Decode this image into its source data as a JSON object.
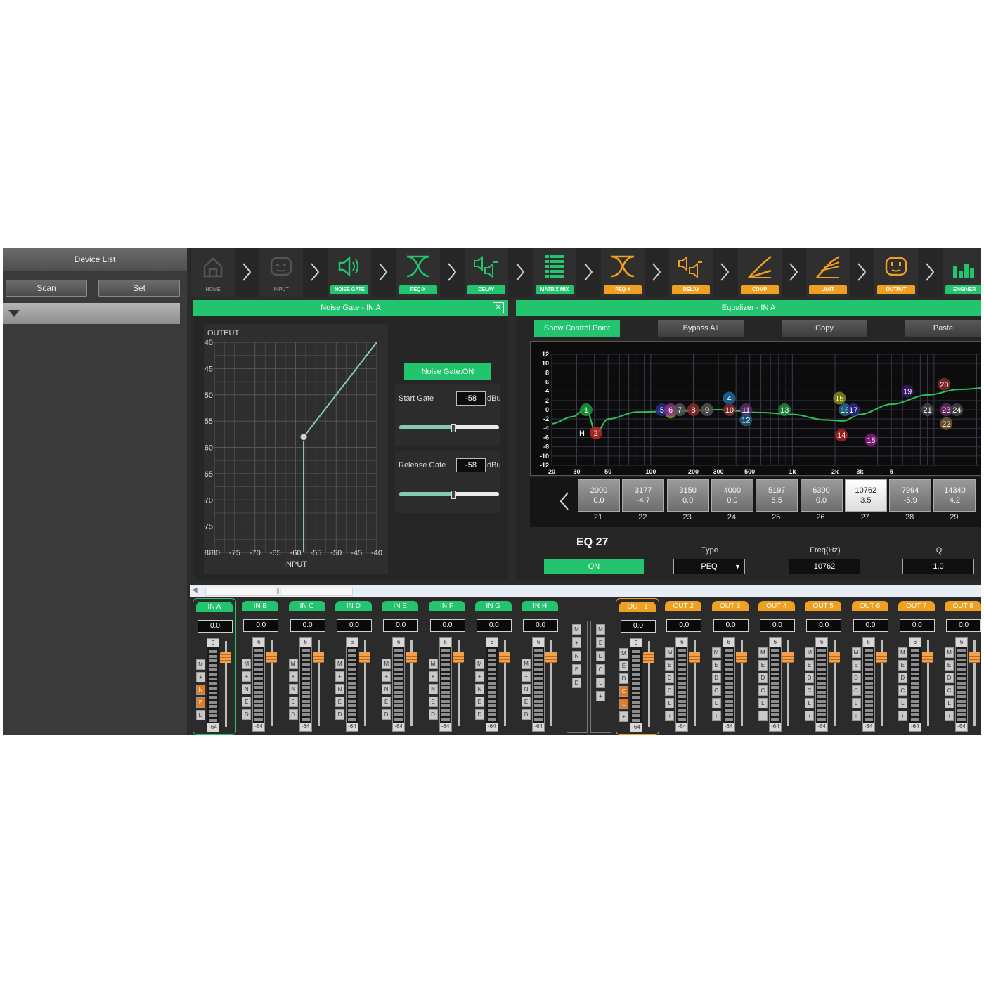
{
  "sidebar": {
    "title": "Device List",
    "scan_label": "Scan",
    "set_label": "Set"
  },
  "toolbar": {
    "items": [
      {
        "label": "HOME",
        "icon": "home-icon",
        "active": false
      },
      {
        "label": "INPUT",
        "icon": "input-icon",
        "active": false
      },
      {
        "label": "NOISE GATE",
        "icon": "speaker-icon",
        "active": true,
        "color": "#22c46e"
      },
      {
        "label": "PEQ-X",
        "icon": "crossover-icon",
        "active": true,
        "color": "#22c46e"
      },
      {
        "label": "DELAY",
        "icon": "delay-speakers-icon",
        "active": true,
        "color": "#22c46e"
      },
      {
        "label": "MATRIX MIX",
        "icon": "matrix-icon",
        "active": true,
        "color": "#22c46e"
      },
      {
        "label": "PEQ-X",
        "icon": "crossover-icon",
        "active": true,
        "color": "#f0a020"
      },
      {
        "label": "DELAY",
        "icon": "delay-speakers-icon",
        "active": true,
        "color": "#f0a020"
      },
      {
        "label": "COMP",
        "icon": "compressor-icon",
        "active": true,
        "color": "#f0a020"
      },
      {
        "label": "LIMIT",
        "icon": "limiter-icon",
        "active": true,
        "color": "#f0a020"
      },
      {
        "label": "OUTPUT",
        "icon": "output-icon",
        "active": true,
        "color": "#f0a020"
      },
      {
        "label": "ENGINER",
        "icon": "meters-icon",
        "active": true,
        "color": "#22c46e"
      }
    ]
  },
  "noise_gate": {
    "title": "Noise Gate - IN A",
    "on_label": "Noise Gate:ON",
    "start_label": "Start Gate",
    "start_value": "-58",
    "start_level": 0.54,
    "release_label": "Release Gate",
    "release_value": "-58",
    "release_level": 0.54,
    "unit": "dBu",
    "y_title": "OUTPUT",
    "x_title": "INPUT",
    "y_ticks": [
      "-40",
      "-45",
      "-50",
      "-55",
      "-60",
      "-65",
      "-70",
      "-75",
      "-80"
    ],
    "x_ticks": [
      "-80",
      "-75",
      "-70",
      "-65",
      "-60",
      "-55",
      "-50",
      "-45",
      "-40"
    ],
    "threshold": -58
  },
  "equalizer": {
    "title": "Equalizer - IN A",
    "show_points_label": "Show Control Point",
    "bypass_label": "Bypass All",
    "copy_label": "Copy",
    "paste_label": "Paste",
    "y_ticks": [
      "12",
      "10",
      "8",
      "6",
      "4",
      "2",
      "0",
      "-2",
      "-4",
      "-6",
      "-8",
      "-10",
      "-12"
    ],
    "x_ticks": [
      "20",
      "30",
      "50",
      "100",
      "200",
      "300",
      "500",
      "1k",
      "2k",
      "3k",
      "5"
    ],
    "points": [
      {
        "n": "1",
        "f": 35,
        "g": 0,
        "c": "#1e9a3a"
      },
      {
        "n": "2",
        "f": 41,
        "g": -5,
        "c": "#c0282a"
      },
      {
        "n": "3",
        "f": 138,
        "g": -0.5,
        "c": "#a08a2a"
      },
      {
        "n": "4",
        "f": 358,
        "g": 2.5,
        "c": "#1e6aa0"
      },
      {
        "n": "5",
        "f": 120,
        "g": 0,
        "c": "#2a2a8a"
      },
      {
        "n": "6",
        "f": 138,
        "g": 0,
        "c": "#8a2a8a"
      },
      {
        "n": "7",
        "f": 160,
        "g": 0,
        "c": "#555555"
      },
      {
        "n": "8",
        "f": 200,
        "g": 0,
        "c": "#8a2a2a"
      },
      {
        "n": "9",
        "f": 250,
        "g": 0,
        "c": "#555555"
      },
      {
        "n": "10",
        "f": 360,
        "g": 0,
        "c": "#7a2a2a"
      },
      {
        "n": "11",
        "f": 470,
        "g": 0,
        "c": "#5a2a6a"
      },
      {
        "n": "12",
        "f": 470,
        "g": -2.2,
        "c": "#1e5a7a"
      },
      {
        "n": "13",
        "f": 880,
        "g": 0,
        "c": "#1e8a3a"
      },
      {
        "n": "14",
        "f": 2220,
        "g": -5.5,
        "c": "#b02020"
      },
      {
        "n": "15",
        "f": 2150,
        "g": 2.5,
        "c": "#8a8a1a"
      },
      {
        "n": "16",
        "f": 2350,
        "g": 0,
        "c": "#1e6a8a"
      },
      {
        "n": "17",
        "f": 2700,
        "g": 0,
        "c": "#2a2a8a"
      },
      {
        "n": "18",
        "f": 3600,
        "g": -6.5,
        "c": "#8a1a8a"
      },
      {
        "n": "19",
        "f": 6500,
        "g": 4,
        "c": "#3a1a6a"
      },
      {
        "n": "20",
        "f": 11800,
        "g": 5.5,
        "c": "#8a2a2a"
      },
      {
        "n": "21",
        "f": 9000,
        "g": 0,
        "c": "#444444"
      },
      {
        "n": "22",
        "f": 12200,
        "g": -3,
        "c": "#7a5a3a"
      },
      {
        "n": "23",
        "f": 12200,
        "g": 0,
        "c": "#6a2a6a"
      },
      {
        "n": "24",
        "f": 14500,
        "g": 0,
        "c": "#444444"
      }
    ],
    "bands": [
      {
        "freq": "2000",
        "gain": "0.0",
        "num": "21"
      },
      {
        "freq": "3177",
        "gain": "-4.7",
        "num": "22"
      },
      {
        "freq": "3150",
        "gain": "0.0",
        "num": "23"
      },
      {
        "freq": "4000",
        "gain": "0.0",
        "num": "24"
      },
      {
        "freq": "5197",
        "gain": "5.5",
        "num": "25"
      },
      {
        "freq": "6300",
        "gain": "0.0",
        "num": "26"
      },
      {
        "freq": "10762",
        "gain": "3.5",
        "num": "27",
        "selected": true
      },
      {
        "freq": "7994",
        "gain": "-5.9",
        "num": "28"
      },
      {
        "freq": "14340",
        "gain": "4.2",
        "num": "29"
      }
    ],
    "selected_name": "EQ 27",
    "on_label": "ON",
    "type_label": "Type",
    "type_value": "PEQ",
    "freq_label": "Freq(Hz)",
    "freq_value": "10762",
    "q_label": "Q",
    "q_value": "1.0"
  },
  "channels": {
    "inputs": [
      {
        "name": "IN A",
        "value": "0.0",
        "buttons": [
          "M",
          "+",
          "N",
          "E",
          "D"
        ],
        "active": [
          "N",
          "E"
        ],
        "selected": true
      },
      {
        "name": "IN B",
        "value": "0.0",
        "buttons": [
          "M",
          "+",
          "N",
          "E",
          "D"
        ],
        "active": []
      },
      {
        "name": "IN C",
        "value": "0.0",
        "buttons": [
          "M",
          "+",
          "N",
          "E",
          "D"
        ],
        "active": []
      },
      {
        "name": "IN D",
        "value": "0.0",
        "buttons": [
          "M",
          "+",
          "N",
          "E",
          "D"
        ],
        "active": []
      },
      {
        "name": "IN E",
        "value": "0.0",
        "buttons": [
          "M",
          "+",
          "N",
          "E",
          "D"
        ],
        "active": []
      },
      {
        "name": "IN F",
        "value": "0.0",
        "buttons": [
          "M",
          "+",
          "N",
          "E",
          "D"
        ],
        "active": []
      },
      {
        "name": "IN G",
        "value": "0.0",
        "buttons": [
          "M",
          "+",
          "N",
          "E",
          "D"
        ],
        "active": []
      },
      {
        "name": "IN H",
        "value": "0.0",
        "buttons": [
          "M",
          "+",
          "N",
          "E",
          "D"
        ],
        "active": []
      }
    ],
    "group_a": [
      "M",
      "+",
      "N",
      "E",
      "D"
    ],
    "group_b": [
      "M",
      "E",
      "D",
      "C",
      "L",
      "+"
    ],
    "outputs": [
      {
        "name": "OUT 1",
        "value": "0.0",
        "buttons": [
          "M",
          "E",
          "D",
          "C",
          "L",
          "+"
        ],
        "active": [
          "C",
          "L"
        ],
        "selected": true
      },
      {
        "name": "OUT 2",
        "value": "0.0",
        "buttons": [
          "M",
          "E",
          "D",
          "C",
          "L",
          "+"
        ],
        "active": []
      },
      {
        "name": "OUT 3",
        "value": "0.0",
        "buttons": [
          "M",
          "E",
          "D",
          "C",
          "L",
          "+"
        ],
        "active": []
      },
      {
        "name": "OUT 4",
        "value": "0.0",
        "buttons": [
          "M",
          "E",
          "D",
          "C",
          "L",
          "+"
        ],
        "active": []
      },
      {
        "name": "OUT 5",
        "value": "0.0",
        "buttons": [
          "M",
          "E",
          "D",
          "C",
          "L",
          "+"
        ],
        "active": []
      },
      {
        "name": "OUT 6",
        "value": "0.0",
        "buttons": [
          "M",
          "E",
          "D",
          "C",
          "L",
          "+"
        ],
        "active": []
      },
      {
        "name": "OUT 7",
        "value": "0.0",
        "buttons": [
          "M",
          "E",
          "D",
          "C",
          "L",
          "+"
        ],
        "active": []
      },
      {
        "name": "OUT 8",
        "value": "0.0",
        "buttons": [
          "M",
          "E",
          "D",
          "C",
          "L",
          "+"
        ],
        "active": []
      }
    ],
    "meter_top": "6",
    "meter_bottom": "-64",
    "input_color": "#22c46e",
    "output_color": "#f0a020"
  }
}
